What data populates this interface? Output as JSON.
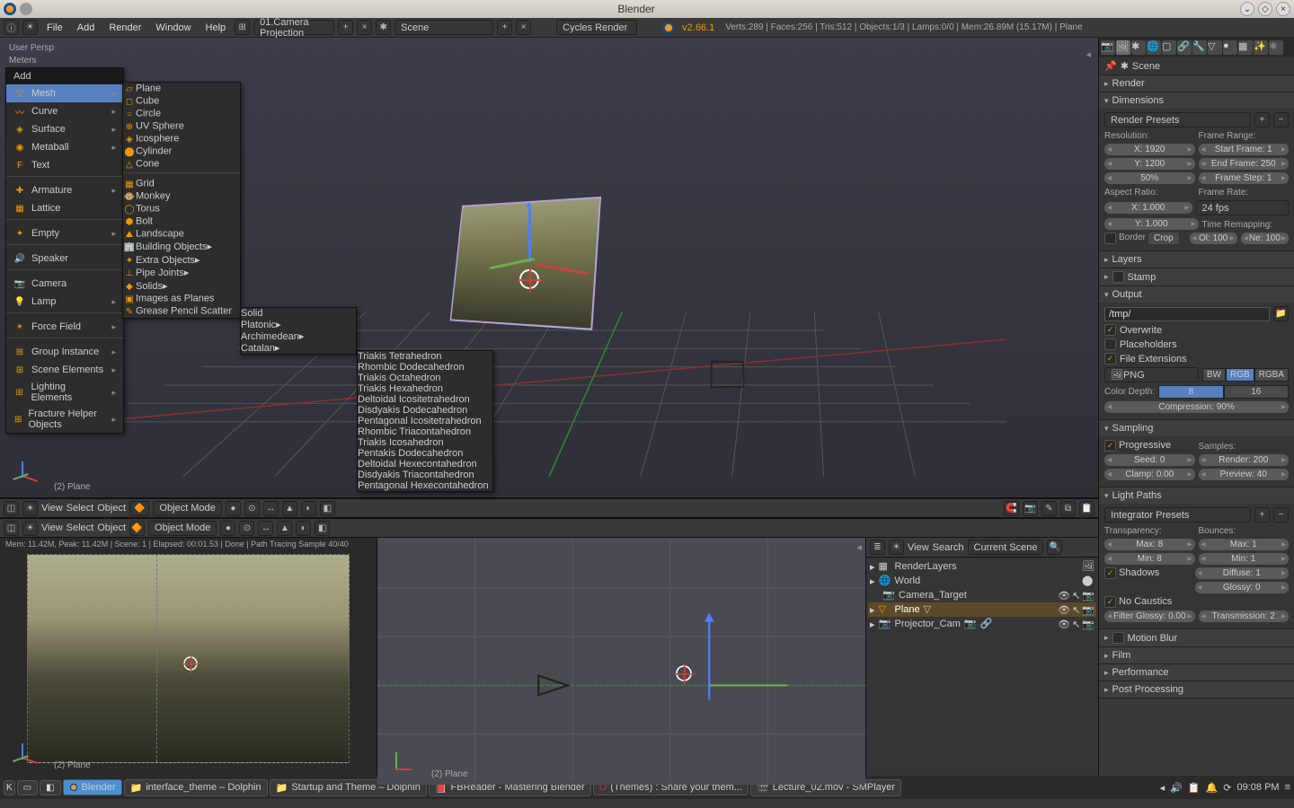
{
  "titlebar": {
    "title": "Blender"
  },
  "topmenu": {
    "file": "File",
    "add": "Add",
    "render": "Render",
    "window": "Window",
    "help": "Help"
  },
  "layout_name": "01.Camera Projection",
  "scene_name": "Scene",
  "render_engine": "Cycles Render",
  "version": "v2.66.1",
  "stats": "Verts:289 | Faces:256 | Tris:512 | Objects:1/3 | Lamps:0/0 | Mem:26.89M (15.17M) | Plane",
  "viewport": {
    "persp": "User Persp",
    "meters": "Meters",
    "obj_label": "(2) Plane"
  },
  "vp_header": {
    "view": "View",
    "select": "Select",
    "object": "Object",
    "mode": "Object Mode"
  },
  "render_view": {
    "info": "Mem: 11.42M, Peak: 11.42M | Scene: 1 | Elapsed: 00:01.53 | Done | Path Tracing Sample 40/40",
    "label": "(2) Plane"
  },
  "top_view": {
    "label": "(2) Plane"
  },
  "outliner": {
    "view": "View",
    "search": "Search",
    "current": "Current Scene",
    "items": [
      {
        "name": "RenderLayers",
        "icon": "layers"
      },
      {
        "name": "World",
        "icon": "world"
      },
      {
        "name": "Camera_Target",
        "icon": "camera"
      },
      {
        "name": "Plane",
        "icon": "mesh",
        "selected": true
      },
      {
        "name": "Projector_Cam",
        "icon": "camera"
      }
    ]
  },
  "breadcrumb": {
    "scene": "Scene"
  },
  "props": {
    "render": "Render",
    "dimensions": {
      "title": "Dimensions",
      "presets": "Render Presets",
      "resolution": "Resolution:",
      "res_x": "X: 1920",
      "res_y": "Y: 1200",
      "res_pct": "50%",
      "framerange": "Frame Range:",
      "start": "Start Frame: 1",
      "end": "End Frame: 250",
      "step": "Frame Step: 1",
      "aspect": "Aspect Ratio:",
      "asp_x": "X: 1.000",
      "asp_y": "Y: 1.000",
      "framerate": "Frame Rate:",
      "fps": "24 fps",
      "remap": "Time Remapping:",
      "old": "Ol: 100",
      "new": "Ne: 100",
      "border": "Border",
      "crop": "Crop"
    },
    "layers": "Layers",
    "stamp": "Stamp",
    "output": {
      "title": "Output",
      "path": "/tmp/",
      "overwrite": "Overwrite",
      "placeholders": "Placeholders",
      "file_ext": "File Extensions",
      "format": "PNG",
      "bw": "BW",
      "rgb": "RGB",
      "rgba": "RGBA",
      "depth": "Color Depth:",
      "d8": "8",
      "d16": "16",
      "compression": "Compression: 90%"
    },
    "sampling": {
      "title": "Sampling",
      "progressive": "Progressive",
      "samples": "Samples:",
      "seed": "Seed: 0",
      "render": "Render: 200",
      "clamp": "Clamp: 0.00",
      "preview": "Preview: 40"
    },
    "lightpaths": {
      "title": "Light Paths",
      "presets": "Integrator Presets",
      "transparency": "Transparency:",
      "tmax": "Max: 8",
      "tmin": "Min: 8",
      "bounces": "Bounces:",
      "bmax": "Max: 1",
      "bmin": "Min: 1",
      "shadows": "Shadows",
      "diffuse": "Diffuse: 1",
      "glossy": "Glossy: 0",
      "nocaustics": "No Caustics",
      "filter": "Filter Glossy: 0.00",
      "transmission": "Transmission: 2"
    },
    "motion_blur": "Motion Blur",
    "film": "Film",
    "performance": "Performance",
    "post": "Post Processing"
  },
  "add_menu": {
    "title": "Add",
    "items": [
      "Mesh",
      "Curve",
      "Surface",
      "Metaball",
      "Text",
      "Armature",
      "Lattice",
      "Empty",
      "Speaker",
      "Camera",
      "Lamp",
      "Force Field",
      "Group Instance",
      "Scene Elements",
      "Lighting Elements",
      "Fracture Helper Objects"
    ]
  },
  "mesh_menu": {
    "items": [
      "Plane",
      "Cube",
      "Circle",
      "UV Sphere",
      "Icosphere",
      "Cylinder",
      "Cone",
      "Grid",
      "Monkey",
      "Torus",
      "Bolt",
      "Landscape",
      "Building Objects",
      "Extra Objects",
      "Pipe Joints",
      "Solids",
      "Images as Planes",
      "Grease Pencil Scatter"
    ]
  },
  "solids_menu": {
    "items": [
      "Solid",
      "Platonic",
      "Archimedean",
      "Catalan"
    ]
  },
  "catalan_menu": {
    "items": [
      "Triakis Tetrahedron",
      "Rhombic Dodecahedron",
      "Triakis Octahedron",
      "Triakis Hexahedron",
      "Deltoidal Icositetrahedron",
      "Disdyakis Dodecahedron",
      "Pentagonal Icositetrahedron",
      "Rhombic Triacontahedron",
      "Triakis Icosahedron",
      "Pentakis Dodecahedron",
      "Deltoidal Hexecontahedron",
      "Disdyakis Triacontahedron",
      "Pentagonal Hexecontahedron"
    ]
  },
  "taskbar": {
    "items": [
      {
        "label": "Blender",
        "active": true
      },
      {
        "label": "interface_theme – Dolphin"
      },
      {
        "label": "Startup and Theme – Dolphin"
      },
      {
        "label": "FBReader - Mastering Blender"
      },
      {
        "label": "(Themes) : Share your them..."
      },
      {
        "label": "Lecture_02.mov - SMPlayer"
      }
    ],
    "clock": "09:08 PM"
  }
}
